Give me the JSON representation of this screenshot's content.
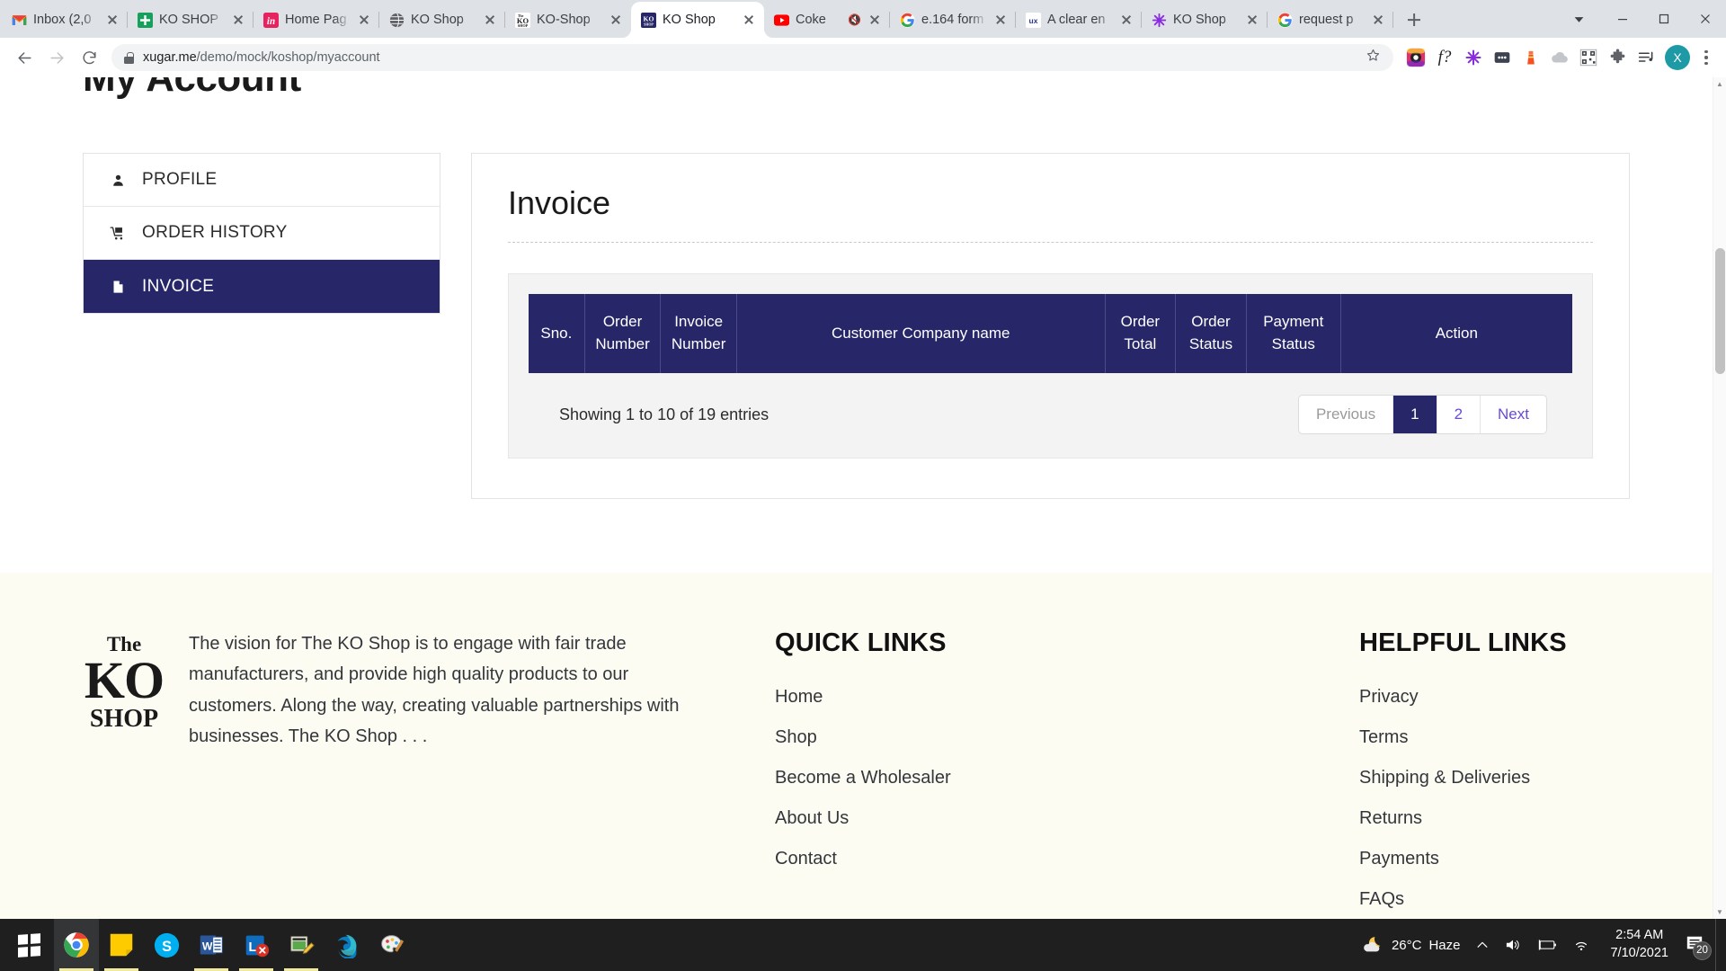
{
  "browser": {
    "tabs": [
      {
        "title": "Inbox (2,0",
        "favicon": "gmail-icon",
        "muted": false,
        "active": false
      },
      {
        "title": "KO SHOP",
        "favicon": "green-plus-icon",
        "muted": false,
        "active": false
      },
      {
        "title": "Home Pag",
        "favicon": "linkedin-icon",
        "muted": false,
        "active": false
      },
      {
        "title": "KO Shop",
        "favicon": "globe-icon",
        "muted": false,
        "active": false
      },
      {
        "title": "KO-Shop",
        "favicon": "ko-shop-wordmark-icon",
        "muted": false,
        "active": false
      },
      {
        "title": "KO Shop",
        "favicon": "ko-shop-navy-icon",
        "muted": false,
        "active": true
      },
      {
        "title": "Coke",
        "favicon": "youtube-icon",
        "muted": true,
        "active": false
      },
      {
        "title": "e.164 form",
        "favicon": "google-icon",
        "muted": false,
        "active": false
      },
      {
        "title": "A clear en",
        "favicon": "ux-icon",
        "muted": false,
        "active": false
      },
      {
        "title": "KO Shop",
        "favicon": "purple-asterisk-icon",
        "muted": false,
        "active": false
      },
      {
        "title": "request p",
        "favicon": "google-icon",
        "muted": false,
        "active": false
      }
    ],
    "new_tab_label": "+",
    "window_controls": {
      "minimize": "—",
      "maximize": "❐",
      "close": "✕",
      "chevron": "▼"
    },
    "nav": {
      "back": "←",
      "forward": "→",
      "reload": "⟳"
    },
    "omnibox": {
      "domain": "xugar.me",
      "path": "/demo/mock/koshop/myaccount",
      "secure_icon": "lock-icon",
      "bookmark_icon": "star-icon"
    },
    "extensions": [
      "instagram-downloader-icon",
      "fontface-ninja-icon",
      "purple-asterisk-icon",
      "dots-box-icon",
      "lighthouse-icon",
      "cloud-icon",
      "qr-code-icon",
      "puzzle-piece-icon",
      "playlist-music-icon"
    ],
    "profile_initial": "X",
    "menu_icon": "kebab-menu-icon"
  },
  "page": {
    "title": "My Account",
    "sidebar": {
      "items": [
        {
          "label": "PROFILE",
          "icon": "user-icon",
          "active": false
        },
        {
          "label": "ORDER HISTORY",
          "icon": "cart-icon",
          "active": false
        },
        {
          "label": "INVOICE",
          "icon": "document-icon",
          "active": true
        }
      ]
    },
    "invoice": {
      "heading": "Invoice",
      "columns": [
        "Sno.",
        "Order Number",
        "Invoice Number",
        "Customer Company name",
        "Order Total",
        "Order Status",
        "Payment Status",
        "Action"
      ],
      "rows": [],
      "showing_text": "Showing 1 to 10 of 19 entries",
      "pagination": [
        {
          "label": "Previous",
          "state": "disabled"
        },
        {
          "label": "1",
          "state": "current"
        },
        {
          "label": "2",
          "state": "normal"
        },
        {
          "label": "Next",
          "state": "normal"
        }
      ]
    }
  },
  "footer": {
    "logo": {
      "line1": "The",
      "line2": "KO",
      "line3": "SHOP"
    },
    "about_text": "The vision for The KO Shop is to engage with fair trade manufacturers, and provide high quality products to our customers. Along the way, creating valuable partnerships with businesses. The KO Shop  . . .",
    "quick_links": {
      "heading": "QUICK LINKS",
      "links": [
        "Home",
        "Shop",
        "Become a Wholesaler",
        "About Us",
        "Contact"
      ]
    },
    "helpful_links": {
      "heading": "HELPFUL LINKS",
      "links": [
        "Privacy",
        "Terms",
        "Shipping & Deliveries",
        "Returns",
        "Payments",
        "FAQs"
      ]
    }
  },
  "taskbar": {
    "start_icon": "windows-logo-icon",
    "apps": [
      {
        "name": "chrome-icon",
        "active": true
      },
      {
        "name": "sticky-notes-icon",
        "active": false
      },
      {
        "name": "skype-icon",
        "active": false
      },
      {
        "name": "word-icon",
        "active": false
      },
      {
        "name": "lync-icon",
        "active": false
      },
      {
        "name": "snipping-tool-icon",
        "active": false
      },
      {
        "name": "edge-icon",
        "active": false
      },
      {
        "name": "paint-icon",
        "active": false
      }
    ],
    "weather": {
      "icon": "moon-cloud-icon",
      "temp": "26°C",
      "condition": "Haze"
    },
    "tray_icons": [
      "chevron-up-icon",
      "volume-icon",
      "battery-icon",
      "wifi-icon"
    ],
    "clock": {
      "time": "2:54 AM",
      "date": "7/10/2021"
    },
    "notifications": {
      "icon": "notification-icon",
      "count": "20"
    }
  },
  "colors": {
    "navy": "#262668",
    "footer_bg": "#fdfcf2",
    "link_purple": "#6a4ad6",
    "table_panel": "#f3f3f3"
  }
}
